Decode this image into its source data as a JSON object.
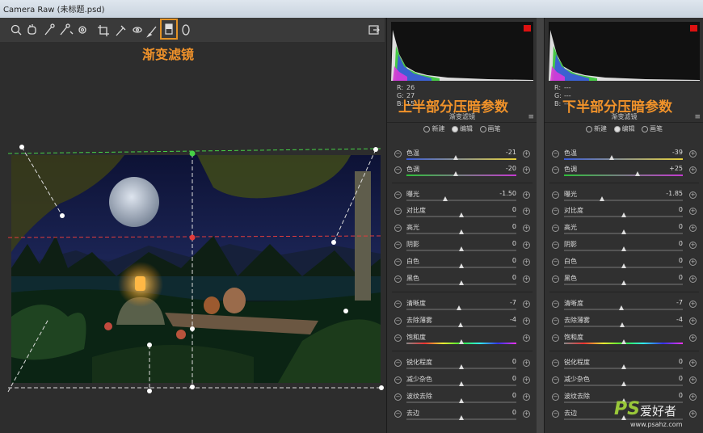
{
  "window": {
    "title": "Camera Raw (未标题.psd)"
  },
  "toolbar": {
    "tools": [
      {
        "name": "zoom-tool-icon",
        "glyph": "🔍"
      },
      {
        "name": "hand-tool-icon",
        "glyph": "✋"
      },
      {
        "name": "white-balance-tool-icon",
        "glyph": "⁄"
      },
      {
        "name": "color-sampler-tool-icon",
        "glyph": "⁄"
      },
      {
        "name": "targeted-adjustment-tool-icon",
        "glyph": "◎"
      },
      {
        "name": "crop-tool-icon",
        "glyph": "⌗"
      },
      {
        "name": "spot-removal-tool-icon",
        "glyph": "✎"
      },
      {
        "name": "red-eye-tool-icon",
        "glyph": "⊕"
      },
      {
        "name": "adjustment-brush-icon",
        "glyph": "╱"
      },
      {
        "name": "graduated-filter-icon",
        "glyph": "▥"
      },
      {
        "name": "radial-filter-icon",
        "glyph": "○"
      }
    ],
    "selected_tool": "graduated-filter-icon",
    "open_image_icon": "export-icon"
  },
  "annotations": {
    "tool_caption": "渐变滤镜",
    "panel_a_caption": "上半部分压暗参数",
    "panel_b_caption": "下半部分压暗参数"
  },
  "panel_a": {
    "rgb": {
      "r": "26",
      "g": "27",
      "b": "15"
    },
    "header": "渐变滤镜",
    "modes": [
      "新建",
      "编辑",
      "画笔"
    ],
    "selected_mode": "编辑",
    "sliders": [
      {
        "label": "色温",
        "value": "-21",
        "pos": 0.45,
        "track": "temp"
      },
      {
        "label": "色调",
        "value": "-20",
        "pos": 0.45,
        "track": "tint"
      },
      {
        "label": "曝光",
        "value": "-1.50",
        "pos": 0.35,
        "track": "gray"
      },
      {
        "label": "对比度",
        "value": "0",
        "pos": 0.5,
        "track": "gray"
      },
      {
        "label": "高光",
        "value": "0",
        "pos": 0.5,
        "track": "gray"
      },
      {
        "label": "阴影",
        "value": "0",
        "pos": 0.5,
        "track": "gray"
      },
      {
        "label": "白色",
        "value": "0",
        "pos": 0.5,
        "track": "gray"
      },
      {
        "label": "黑色",
        "value": "0",
        "pos": 0.5,
        "track": "gray"
      },
      {
        "label": "清晰度",
        "value": "-7",
        "pos": 0.48,
        "track": "gray"
      },
      {
        "label": "去除薄雾",
        "value": "-4",
        "pos": 0.49,
        "track": "gray"
      },
      {
        "label": "饱和度",
        "value": "",
        "pos": 0.5,
        "track": "sat"
      },
      {
        "label": "锐化程度",
        "value": "0",
        "pos": 0.5,
        "track": "gray"
      },
      {
        "label": "减少杂色",
        "value": "0",
        "pos": 0.5,
        "track": "gray"
      },
      {
        "label": "波纹去除",
        "value": "0",
        "pos": 0.5,
        "track": "gray"
      },
      {
        "label": "去边",
        "value": "0",
        "pos": 0.5,
        "track": "gray"
      }
    ]
  },
  "panel_b": {
    "rgb": {
      "r": "---",
      "g": "---",
      "b": "---"
    },
    "header": "渐变滤镜",
    "modes": [
      "新建",
      "编辑",
      "画笔"
    ],
    "selected_mode": "编辑",
    "sliders": [
      {
        "label": "色温",
        "value": "-39",
        "pos": 0.4,
        "track": "temp"
      },
      {
        "label": "色调",
        "value": "+25",
        "pos": 0.62,
        "track": "tint"
      },
      {
        "label": "曝光",
        "value": "-1.85",
        "pos": 0.32,
        "track": "gray"
      },
      {
        "label": "对比度",
        "value": "0",
        "pos": 0.5,
        "track": "gray"
      },
      {
        "label": "高光",
        "value": "0",
        "pos": 0.5,
        "track": "gray"
      },
      {
        "label": "阴影",
        "value": "0",
        "pos": 0.5,
        "track": "gray"
      },
      {
        "label": "白色",
        "value": "0",
        "pos": 0.5,
        "track": "gray"
      },
      {
        "label": "黑色",
        "value": "0",
        "pos": 0.5,
        "track": "gray"
      },
      {
        "label": "清晰度",
        "value": "-7",
        "pos": 0.48,
        "track": "gray"
      },
      {
        "label": "去除薄雾",
        "value": "-4",
        "pos": 0.49,
        "track": "gray"
      },
      {
        "label": "饱和度",
        "value": "",
        "pos": 0.5,
        "track": "sat"
      },
      {
        "label": "锐化程度",
        "value": "0",
        "pos": 0.5,
        "track": "gray"
      },
      {
        "label": "减少杂色",
        "value": "0",
        "pos": 0.5,
        "track": "gray"
      },
      {
        "label": "波纹去除",
        "value": "0",
        "pos": 0.5,
        "track": "gray"
      },
      {
        "label": "去边",
        "value": "",
        "pos": 0.5,
        "track": "gray"
      }
    ]
  },
  "watermark": {
    "logo": "PS",
    "text": "爱好者",
    "url": "www.psahz.com"
  },
  "colors": {
    "accent": "#f0922a",
    "guide_green": "#46d246",
    "guide_red": "#e23c3c"
  }
}
